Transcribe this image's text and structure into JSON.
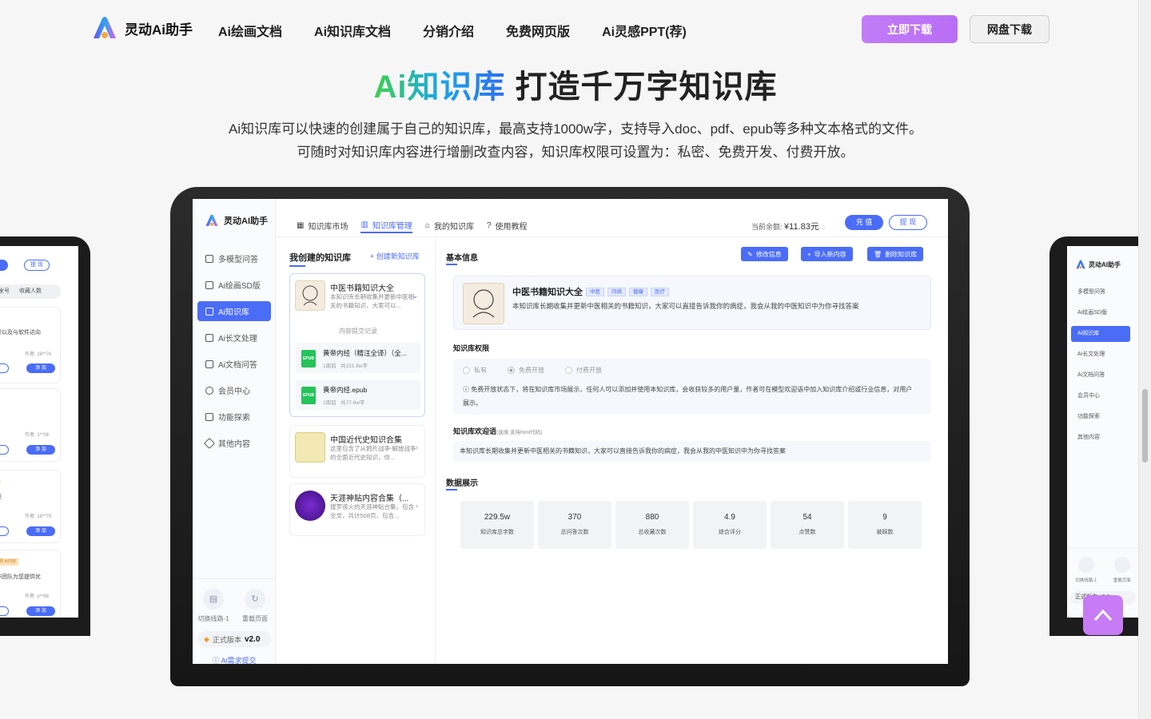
{
  "nav": {
    "logo": "灵动Ai助手",
    "links": [
      "Ai绘画文档",
      "Ai知识库文档",
      "分销介绍",
      "免费网页版",
      "Ai灵感PPT(荐)"
    ],
    "download_btn": "立即下载",
    "cloud_btn": "网盘下载"
  },
  "hero": {
    "title_accent": "Ai知识库",
    "title_rest": " 打造千万字知识库",
    "desc_line1": "Ai知识库可以快速的创建属于自己的知识库，最高支持1000w字，支持导入doc、pdf、epub等多种文本格式的文件。",
    "desc_line2": "可随时对知识库内容进行增删改查内容，知识库权限可设置为：私密、免费开发、付费开放。"
  },
  "app": {
    "logo": "灵动AI助手",
    "menu": [
      "多模型问答",
      "Ai绘画SD版",
      "Ai知识库",
      "Ai长文处理",
      "Ai文档问答",
      "会员中心",
      "功能探索",
      "其他内容"
    ],
    "switch_line": "切换线路-1",
    "reload": "重载页面",
    "version_label": "正式版本",
    "version": "v2.0",
    "feedback": "Ai需求提交",
    "tabs": [
      "知识库市场",
      "知识库管理",
      "我的知识库",
      "使用教程"
    ],
    "balance_label": "当前余额:",
    "balance": "¥11.83元",
    "recharge": "充 值",
    "withdraw": "提 现",
    "kb_header": "我创建的知识库",
    "kb_new": "+ 创建新知识库",
    "kb_list": [
      {
        "title": "中医书籍知识大全",
        "desc": "本知识库长期收集并更新中医相关的书籍知识，大家可以..."
      },
      {
        "title": "中国近代史知识合集",
        "desc": "这里包含了从鸦片战争-解放战争的全面近代史知识，你..."
      },
      {
        "title": "天涯神贴内容合集（...",
        "desc": "搜罗很火的天涯神贴合集，包含全文，共计508页，包含..."
      }
    ],
    "submit_record": "内容提交记录",
    "files": [
      {
        "name": "黄帝内经（精注全译）（全...",
        "time": "1周前",
        "size": "共151.8w字"
      },
      {
        "name": "黄帝内经.epub",
        "time": "1周前",
        "size": "共77.6w字"
      }
    ],
    "basic_info": "基本信息",
    "actions": [
      "修改信息",
      "导入新内容",
      "删除知识库"
    ],
    "kb_title": "中医书籍知识大全",
    "tags": [
      "中医",
      "问病",
      "健康",
      "医疗"
    ],
    "kb_desc": "本知识库长期收集并更新中医相关的书籍知识，大家可以直接告诉我你的病症，我会从我的中医知识中为你寻找答案",
    "perm_title": "知识库权限",
    "perm_options": [
      "私有",
      "免费开放",
      "付费开放"
    ],
    "perm_note": "ⓘ 免费开放状态下，将在知识库市场展示，任何人可以添加并使用本知识库，会收获较多的用户量，作者可在模型欢迎语中加入知识库介绍或行业信息，对用户展示。",
    "welcome_title": "知识库欢迎语",
    "welcome_hint": "(选填 支持html代码)",
    "welcome_text": "本知识库长期收集并更新中医相关的书籍知识，大家可以直接告诉我你的病症，我会从我的中医知识中为你寻找答案",
    "stats_title": "数据展示",
    "stats": [
      {
        "value": "229.5w",
        "label": "知识库总字数"
      },
      {
        "value": "370",
        "label": "总问答次数"
      },
      {
        "value": "880",
        "label": "总收藏次数"
      },
      {
        "value": "4.9",
        "label": "综合评分"
      },
      {
        "value": "54",
        "label": "点赞数"
      },
      {
        "value": "9",
        "label": "被踩数"
      }
    ]
  },
  "left_peek": {
    "btn1": "值",
    "btn2": "提 现",
    "tab1": "发号",
    "tab2": "收藏人数",
    "t1": "识以及与软件达向",
    "a1": "作者: 28**76",
    "a2": "作者: 1**08",
    "t3": "识",
    "a3": "作者: 18**79",
    "tag4": "付费 Ai内容",
    "t4": "作团队为您提供优",
    "a4": "作者: p**88",
    "add": "添 加"
  },
  "right_peek": {
    "logo": "灵动AI助手",
    "menu": [
      "多模型问答",
      "Ai绘画SD版",
      "Ai知识库",
      "Ai长文处理",
      "Ai文档问答",
      "会员中心",
      "功能探索",
      "其他内容"
    ],
    "b1": "切换线路-1",
    "b2": "重载页面",
    "version": "正式版本 v2.0"
  }
}
